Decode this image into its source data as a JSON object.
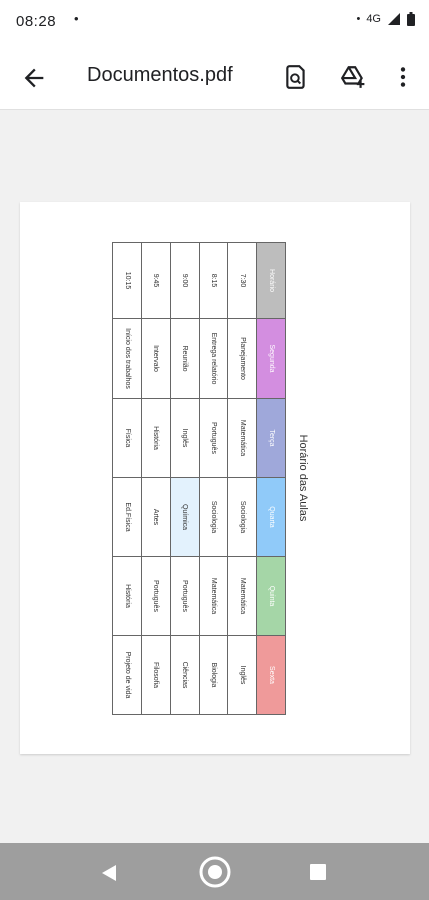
{
  "status_bar": {
    "time": "08:28",
    "dot": "•",
    "network": "4G"
  },
  "app_bar": {
    "title": "Documentos.pdf"
  },
  "document": {
    "title": "Horário das Aulas",
    "header_colors": [
      "#bdbdbd",
      "#d38ee0",
      "#9fa8da",
      "#90caf9",
      "#a5d6a7",
      "#ef9a9a"
    ],
    "highlight_color": "#e3f2fd",
    "headers": [
      "Horário",
      "Segunda",
      "Terça",
      "Quarta",
      "Quinta",
      "Sexta"
    ],
    "rows": [
      [
        "7:30",
        "Planejamento",
        "Matemática",
        "Sociologia",
        "Matemática",
        "Inglês"
      ],
      [
        "8:15",
        "Entrega relatório",
        "Português",
        "Sociologia",
        "Matemática",
        "Biologia"
      ],
      [
        "9:00",
        "Reunião",
        "Inglês",
        "Química",
        "Português",
        "Ciências"
      ],
      [
        "9:45",
        "Intervalo",
        "História",
        "Artes",
        "Português",
        "Filosofia"
      ],
      [
        "10:15",
        "Início dos trabalhos",
        "Física",
        "Ed.Física",
        "História",
        "Projeto de vida"
      ]
    ]
  }
}
